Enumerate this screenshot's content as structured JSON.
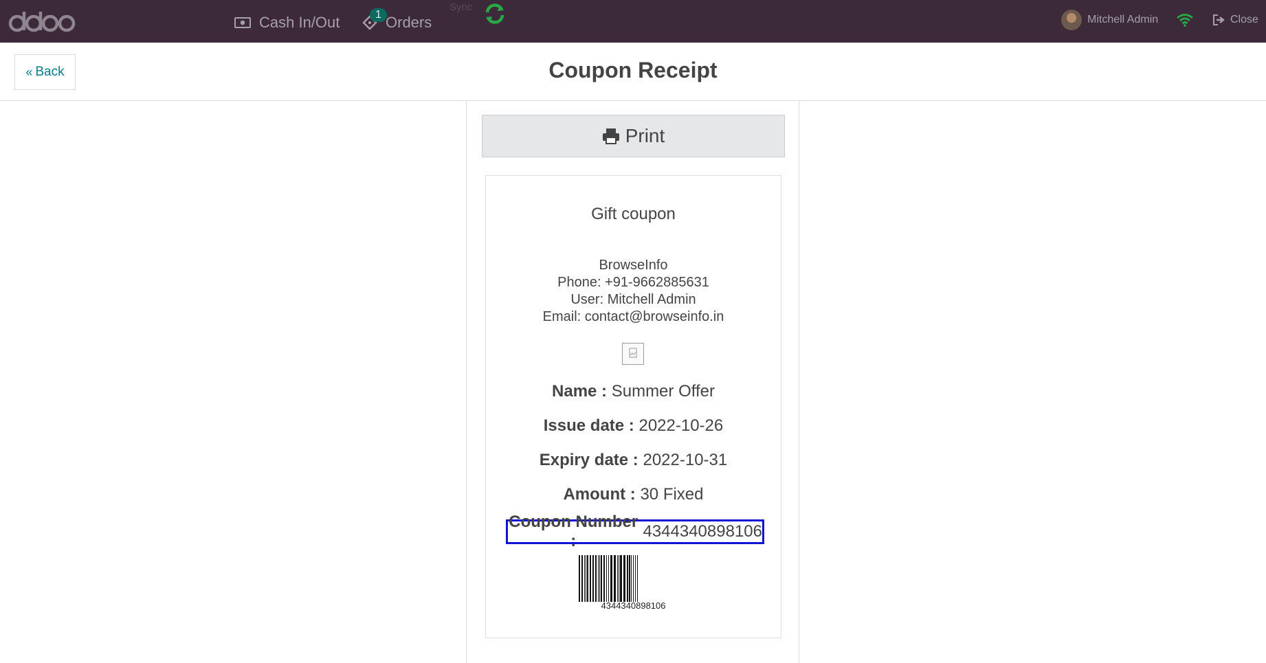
{
  "topbar": {
    "logo_text": "odoo",
    "cash_label": "Cash In/Out",
    "orders_label": "Orders",
    "orders_badge": "1",
    "sync_label": "Sync",
    "user_name": "Mitchell Admin",
    "close_label": "Close",
    "bg_color": "#3c2a3a",
    "icons": [
      "money-icon",
      "ticket-icon",
      "sync-icon",
      "avatar",
      "wifi-icon",
      "sign-out-icon"
    ]
  },
  "header": {
    "back_label": "Back",
    "title": "Coupon Receipt"
  },
  "print_label": "Print",
  "receipt": {
    "title": "Gift coupon",
    "company": "BrowseInfo",
    "phone": "Phone: +91-9662885631",
    "user": "User: Mitchell Admin",
    "email": "Email: contact@browseinfo.in",
    "name_label": "Name :",
    "name_value": "Summer Offer",
    "issue_label": "Issue date :",
    "issue_value": "2022-10-26",
    "expiry_label": "Expiry date :",
    "expiry_value": "2022-10-31",
    "amount_label": "Amount :",
    "amount_value": "30 Fixed",
    "coupon_label": "Coupon Number :",
    "coupon_value": "4344340898106",
    "barcode_text": "4344340898106"
  }
}
